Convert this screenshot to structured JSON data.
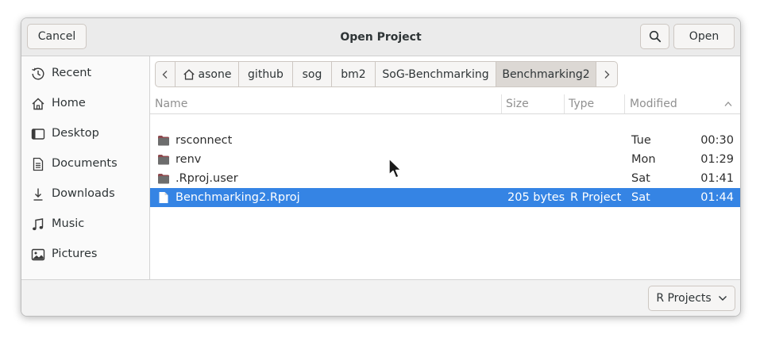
{
  "dialog": {
    "title": "Open Project",
    "cancel_label": "Cancel",
    "open_label": "Open",
    "search_icon": "search-icon"
  },
  "sidebar": {
    "items": [
      {
        "label": "Recent",
        "icon": "clock-icon"
      },
      {
        "label": "Home",
        "icon": "home-icon"
      },
      {
        "label": "Desktop",
        "icon": "desktop-icon"
      },
      {
        "label": "Documents",
        "icon": "document-icon"
      },
      {
        "label": "Downloads",
        "icon": "download-icon"
      },
      {
        "label": "Music",
        "icon": "music-icon"
      },
      {
        "label": "Pictures",
        "icon": "picture-icon"
      }
    ]
  },
  "path": {
    "segments": [
      "asone",
      "github",
      "sog",
      "bm2",
      "SoG-Benchmarking",
      "Benchmarking2"
    ],
    "active": "Benchmarking2"
  },
  "columns": {
    "name": "Name",
    "size": "Size",
    "type": "Type",
    "modified": "Modified"
  },
  "files": [
    {
      "name": "rsconnect",
      "size": "",
      "type": "",
      "day": "Tue",
      "time": "00:30",
      "kind": "folder"
    },
    {
      "name": "renv",
      "size": "",
      "type": "",
      "day": "Mon",
      "time": "01:29",
      "kind": "folder"
    },
    {
      "name": ".Rproj.user",
      "size": "",
      "type": "",
      "day": "Sat",
      "time": "01:41",
      "kind": "folder"
    },
    {
      "name": "Benchmarking2.Rproj",
      "size": "205 bytes",
      "type": "R Project",
      "day": "Sat",
      "time": "01:44",
      "kind": "file",
      "selected": true
    }
  ],
  "filter": {
    "value": "R Projects"
  },
  "colors": {
    "selection": "#3584e4",
    "folder": "#8e4a4e"
  }
}
